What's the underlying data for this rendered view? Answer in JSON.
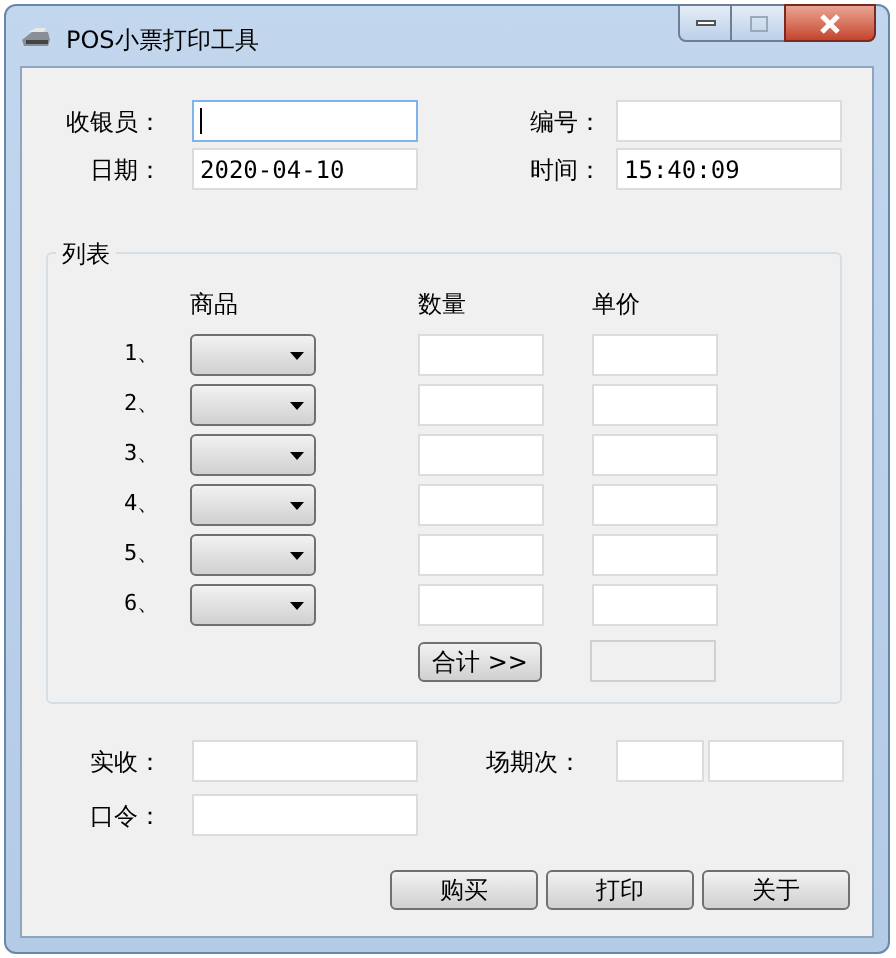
{
  "window": {
    "title": "POS小票打印工具"
  },
  "header_rows": [
    [
      {
        "label": "收银员：",
        "focused": true
      },
      {
        "label": "编号：",
        "focused": false
      }
    ],
    [
      {
        "label": "日期：",
        "value": "2020-04-10",
        "focused": false
      },
      {
        "label": "时间：",
        "value": "15:40:09",
        "focused": false
      }
    ]
  ],
  "list": {
    "title": "列表",
    "columns": [
      "商品",
      "数量",
      "单价"
    ],
    "rows": [
      {
        "number": "1、"
      },
      {
        "number": "2、"
      },
      {
        "number": "3、"
      },
      {
        "number": "4、"
      },
      {
        "number": "5、"
      },
      {
        "number": "6、"
      }
    ],
    "total_button": "合计 >>"
  },
  "received": {
    "label": "实收："
  },
  "session": {
    "label": "场期次："
  },
  "password": {
    "label": "口令："
  },
  "buttons": [
    "购买",
    "打印",
    "关于"
  ]
}
